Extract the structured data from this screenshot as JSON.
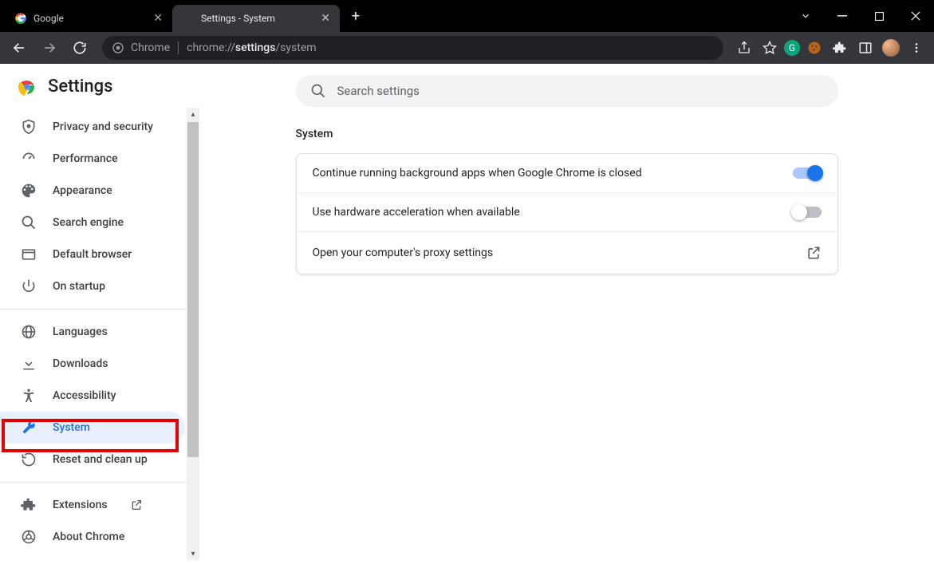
{
  "titlebar": {
    "tabs": [
      {
        "title": "Google",
        "active": false
      },
      {
        "title": "Settings - System",
        "active": true
      }
    ]
  },
  "omnibox": {
    "host_label": "Chrome",
    "url_prefix": "chrome://",
    "url_bold": "settings",
    "url_suffix": "/system"
  },
  "settings_title": "Settings",
  "search_placeholder": "Search settings",
  "sidebar": {
    "items_top": [
      {
        "label": "Privacy and security",
        "icon": "shield"
      },
      {
        "label": "Performance",
        "icon": "speed"
      },
      {
        "label": "Appearance",
        "icon": "palette"
      },
      {
        "label": "Search engine",
        "icon": "search"
      },
      {
        "label": "Default browser",
        "icon": "browser"
      },
      {
        "label": "On startup",
        "icon": "power"
      }
    ],
    "items_mid": [
      {
        "label": "Languages",
        "icon": "globe"
      },
      {
        "label": "Downloads",
        "icon": "download"
      },
      {
        "label": "Accessibility",
        "icon": "accessibility"
      },
      {
        "label": "System",
        "icon": "wrench",
        "active": true
      },
      {
        "label": "Reset and clean up",
        "icon": "restore"
      }
    ],
    "items_bottom": [
      {
        "label": "Extensions",
        "icon": "extension",
        "external": true
      },
      {
        "label": "About Chrome",
        "icon": "chrome"
      }
    ]
  },
  "section": {
    "title": "System",
    "rows": [
      {
        "label": "Continue running background apps when Google Chrome is closed",
        "toggle": "on"
      },
      {
        "label": "Use hardware acceleration when available",
        "toggle": "off"
      },
      {
        "label": "Open your computer's proxy settings",
        "action": "external"
      }
    ]
  }
}
